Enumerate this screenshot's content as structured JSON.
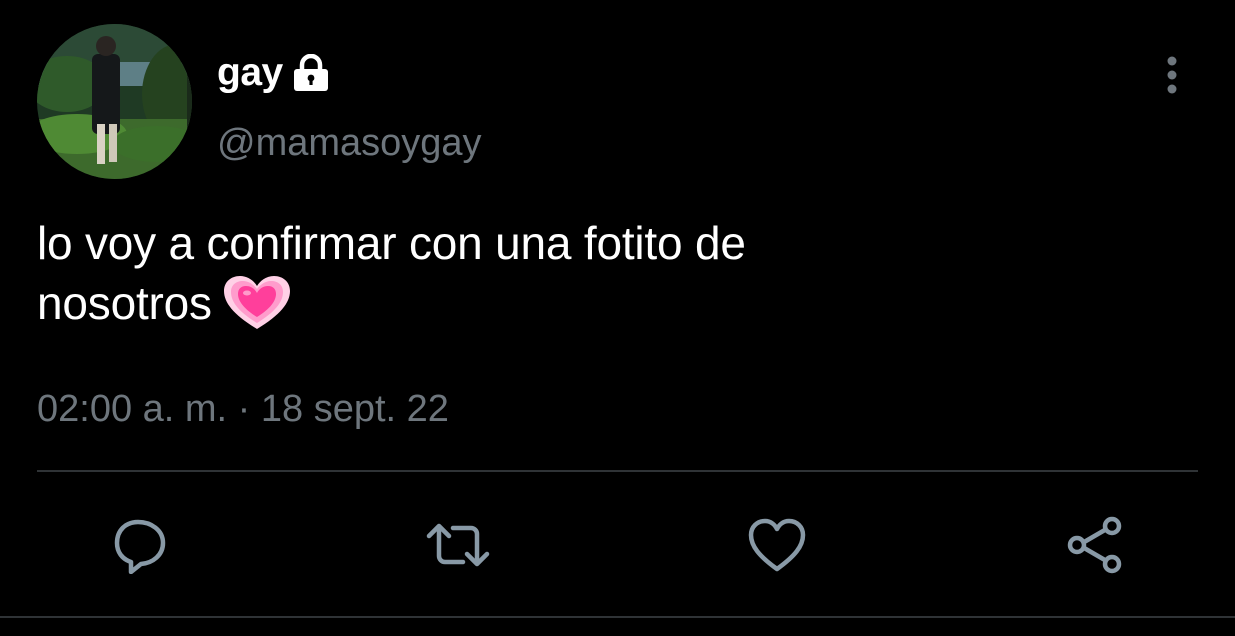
{
  "tweet": {
    "display_name": "gay",
    "handle": "@mamasoygay",
    "text_line_1": "lo voy a confirmar con una fotito de",
    "text_line_2": "nosotros",
    "emoji": "growing-heart",
    "timestamp": "02:00 a. m. · 18 sept. 22",
    "protected": true
  },
  "icons": {
    "lock": "lock-icon",
    "more": "more-vertical-icon",
    "reply": "reply-icon",
    "retweet": "retweet-icon",
    "like": "heart-icon",
    "share": "share-icon"
  },
  "colors": {
    "background": "#000000",
    "text": "#ffffff",
    "secondary": "#6e767d",
    "divider": "#2f3336",
    "action_icon": "#8899a6",
    "emoji_pink": "#ff3f9b"
  }
}
